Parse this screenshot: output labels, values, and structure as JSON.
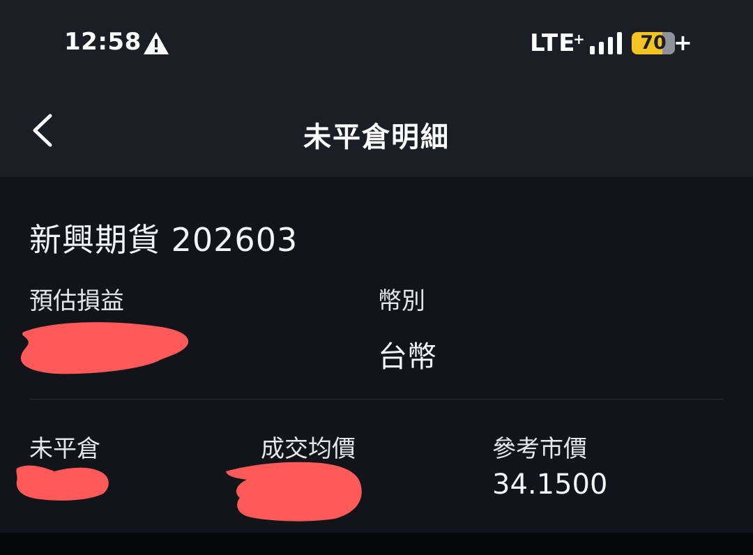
{
  "status_bar": {
    "time": "12:58",
    "network": "LTE",
    "network_plus": "+",
    "battery": "70",
    "charging": "+"
  },
  "nav": {
    "title": "未平倉明細"
  },
  "position": {
    "product_name": "新興期貨 202603",
    "estimated_pnl_label": "預估損益",
    "currency_label": "幣別",
    "currency_value": "台幣",
    "open_qty_label": "未平倉",
    "avg_price_label": "成交均價",
    "ref_price_label": "參考市價",
    "ref_price_value": "34.1500"
  },
  "colors": {
    "background": "#1b1e25",
    "panel": "#121419",
    "battery": "#f4c324",
    "redaction": "#ff5a5a"
  }
}
